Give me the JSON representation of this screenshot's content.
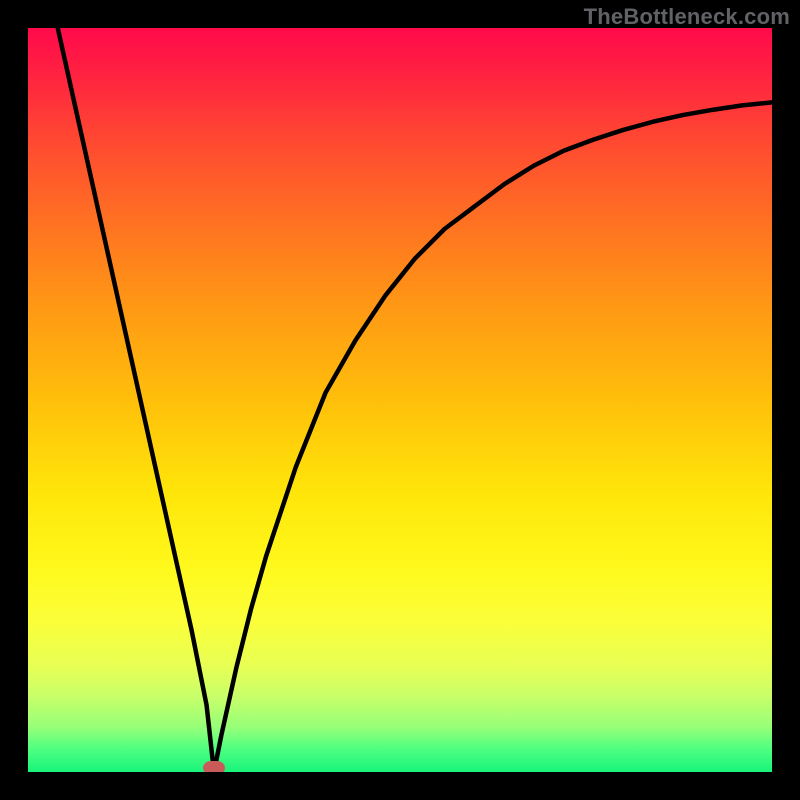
{
  "attribution": "TheBottleneck.com",
  "chart_data": {
    "type": "line",
    "title": "",
    "xlabel": "",
    "ylabel": "",
    "xlim": [
      0,
      100
    ],
    "ylim": [
      0,
      100
    ],
    "series": [
      {
        "name": "bottleneck-curve",
        "x": [
          4,
          6,
          8,
          10,
          12,
          14,
          16,
          18,
          20,
          22,
          24,
          25,
          26,
          28,
          30,
          32,
          34,
          36,
          38,
          40,
          44,
          48,
          52,
          56,
          60,
          64,
          68,
          72,
          76,
          80,
          84,
          88,
          92,
          96,
          100
        ],
        "y": [
          100,
          91,
          82,
          73,
          64,
          55,
          46,
          37,
          28,
          19,
          9,
          0,
          5,
          14,
          22,
          29,
          35,
          41,
          46,
          51,
          58,
          64,
          69,
          73,
          76,
          79,
          81.5,
          83.5,
          85,
          86.3,
          87.4,
          88.3,
          89,
          89.6,
          90
        ]
      }
    ],
    "marker": {
      "name": "min-point",
      "x": 25,
      "y": 0
    },
    "gradient_colors": {
      "top": "#ff0a4b",
      "mid_upper": "#ff9a14",
      "mid": "#ffe409",
      "mid_lower": "#faff3a",
      "bottom": "#18f47a"
    }
  }
}
